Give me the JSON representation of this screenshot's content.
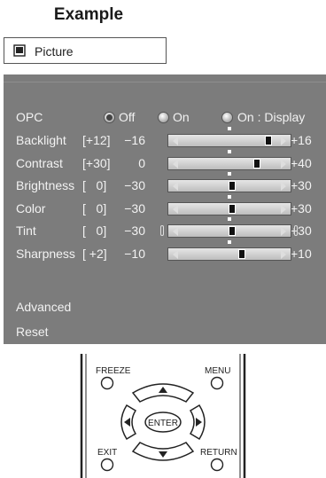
{
  "page_title": "Example",
  "tab": {
    "icon": "tv-icon",
    "label": "Picture"
  },
  "opc": {
    "label": "OPC",
    "options": [
      {
        "label": "Off",
        "selected": true
      },
      {
        "label": "On",
        "selected": false
      },
      {
        "label": "On : Display",
        "selected": false
      }
    ]
  },
  "sliders": [
    {
      "label": "Backlight",
      "bracket": "[+12]",
      "min": "−16",
      "max": "+16",
      "level": 0.875
    },
    {
      "label": "Contrast",
      "bracket": "[+30]",
      "min": "0",
      "max": "+40",
      "level": 0.75
    },
    {
      "label": "Brightness",
      "bracket": "[   0]",
      "min": "−30",
      "max": "+30",
      "level": 0.5
    },
    {
      "label": "Color",
      "bracket": "[   0]",
      "min": "−30",
      "max": "+30",
      "level": 0.5
    },
    {
      "label": "Tint",
      "bracket": "[   0]",
      "min": "−30",
      "max": "+30",
      "level": 0.5,
      "end_markers": true
    },
    {
      "label": "Sharpness",
      "bracket": "[ +2]",
      "min": "−10",
      "max": "+10",
      "level": 0.6
    }
  ],
  "advanced_label": "Advanced",
  "reset_label": "Reset",
  "remote": {
    "freeze": "FREEZE",
    "menu": "MENU",
    "enter": "ENTER",
    "exit": "EXIT",
    "return": "RETURN"
  }
}
